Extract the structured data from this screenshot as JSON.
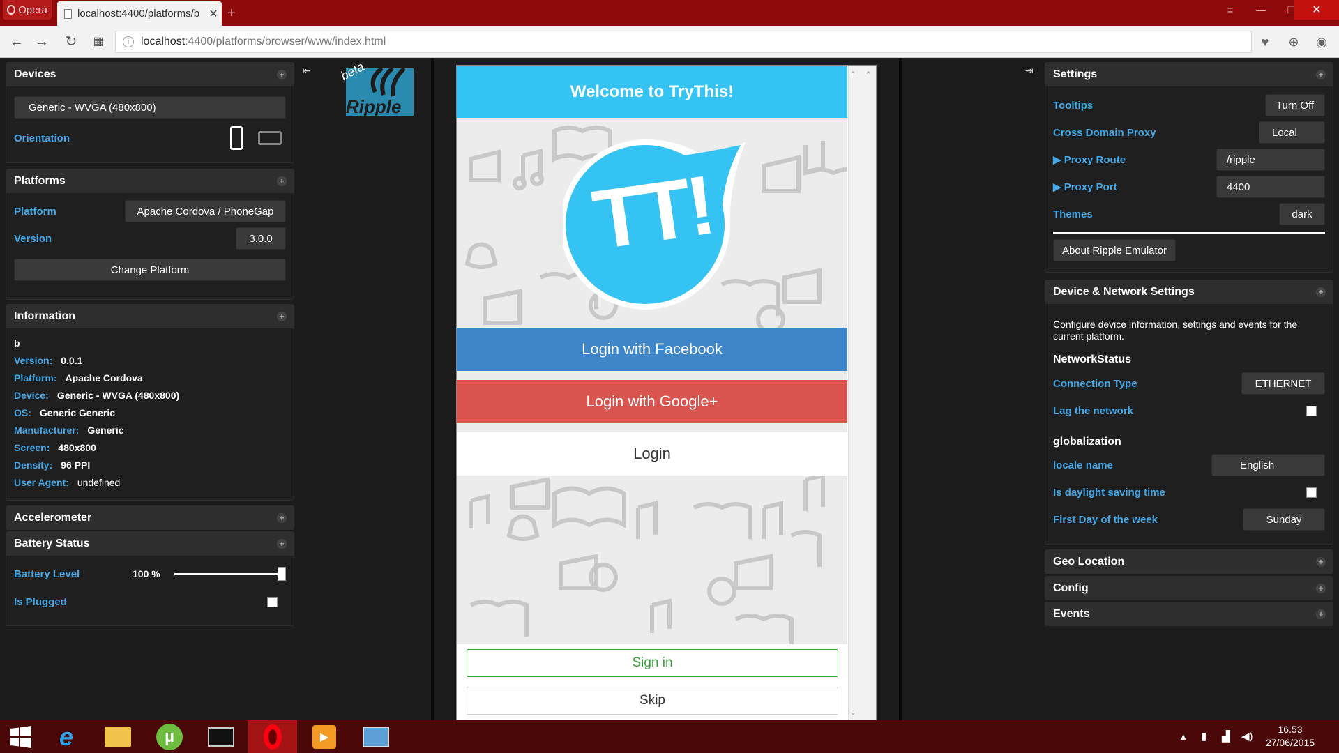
{
  "browser": {
    "app_label": "Opera",
    "tab_title": "localhost:4400/platforms/b",
    "url_host": "localhost",
    "url_path": ":4400/platforms/browser/www/index.html",
    "icons": [
      "back-icon",
      "forward-icon",
      "reload-icon",
      "speed-dial-icon",
      "site-info-icon",
      "heart-icon",
      "download-icon",
      "account-icon"
    ]
  },
  "left": {
    "devices": {
      "title": "Devices",
      "device": "Generic - WVGA (480x800)",
      "orientation_label": "Orientation"
    },
    "platforms": {
      "title": "Platforms",
      "platform_label": "Platform",
      "platform_value": "Apache Cordova / PhoneGap",
      "version_label": "Version",
      "version_value": "3.0.0",
      "change_button": "Change Platform"
    },
    "information": {
      "title": "Information",
      "name": "b",
      "rows": [
        {
          "k": "Version:",
          "v": "0.0.1"
        },
        {
          "k": "Platform:",
          "v": "Apache Cordova"
        },
        {
          "k": "Device:",
          "v": "Generic - WVGA (480x800)"
        },
        {
          "k": "OS:",
          "v": "Generic Generic"
        },
        {
          "k": "Manufacturer:",
          "v": "Generic"
        },
        {
          "k": "Screen:",
          "v": "480x800"
        },
        {
          "k": "Density:",
          "v": "96 PPI"
        },
        {
          "k": "User Agent:",
          "v": "undefined"
        }
      ]
    },
    "accelerometer": {
      "title": "Accelerometer"
    },
    "battery": {
      "title": "Battery Status",
      "level_label": "Battery Level",
      "level_value": "100 %",
      "level_fraction": 1.0,
      "plugged_label": "Is Plugged"
    }
  },
  "ripple_logo": {
    "beta": "beta",
    "name": "Ripple"
  },
  "phone": {
    "header": "Welcome to TryThis!",
    "logo_text": "TT!",
    "facebook": "Login with Facebook",
    "google": "Login with Google+",
    "login": "Login",
    "signin": "Sign in",
    "skip": "Skip",
    "colors": {
      "header": "#35c3f3",
      "facebook": "#3f86c9",
      "google": "#d9534f",
      "signin": "#3aa23a"
    }
  },
  "right": {
    "settings": {
      "title": "Settings",
      "tooltips_label": "Tooltips",
      "tooltips_value": "Turn Off",
      "proxy_label": "Cross Domain Proxy",
      "proxy_value": "Local",
      "route_label": "▶ Proxy Route",
      "route_value": "/ripple",
      "port_label": "▶ Proxy Port",
      "port_value": "4400",
      "themes_label": "Themes",
      "themes_value": "dark",
      "about_button": "About Ripple Emulator"
    },
    "network": {
      "title": "Device & Network Settings",
      "description": "Configure device information, settings and events for the current platform.",
      "network_heading": "NetworkStatus",
      "conn_label": "Connection Type",
      "conn_value": "ETHERNET",
      "lag_label": "Lag the network",
      "glob_heading": "globalization",
      "locale_label": "locale name",
      "locale_value": "English",
      "dst_label": "Is daylight saving time",
      "firstday_label": "First Day of the week",
      "firstday_value": "Sunday"
    },
    "geo": {
      "title": "Geo Location"
    },
    "config": {
      "title": "Config"
    },
    "events": {
      "title": "Events"
    }
  },
  "taskbar": {
    "time": "16.53",
    "date": "27/06/2015"
  }
}
